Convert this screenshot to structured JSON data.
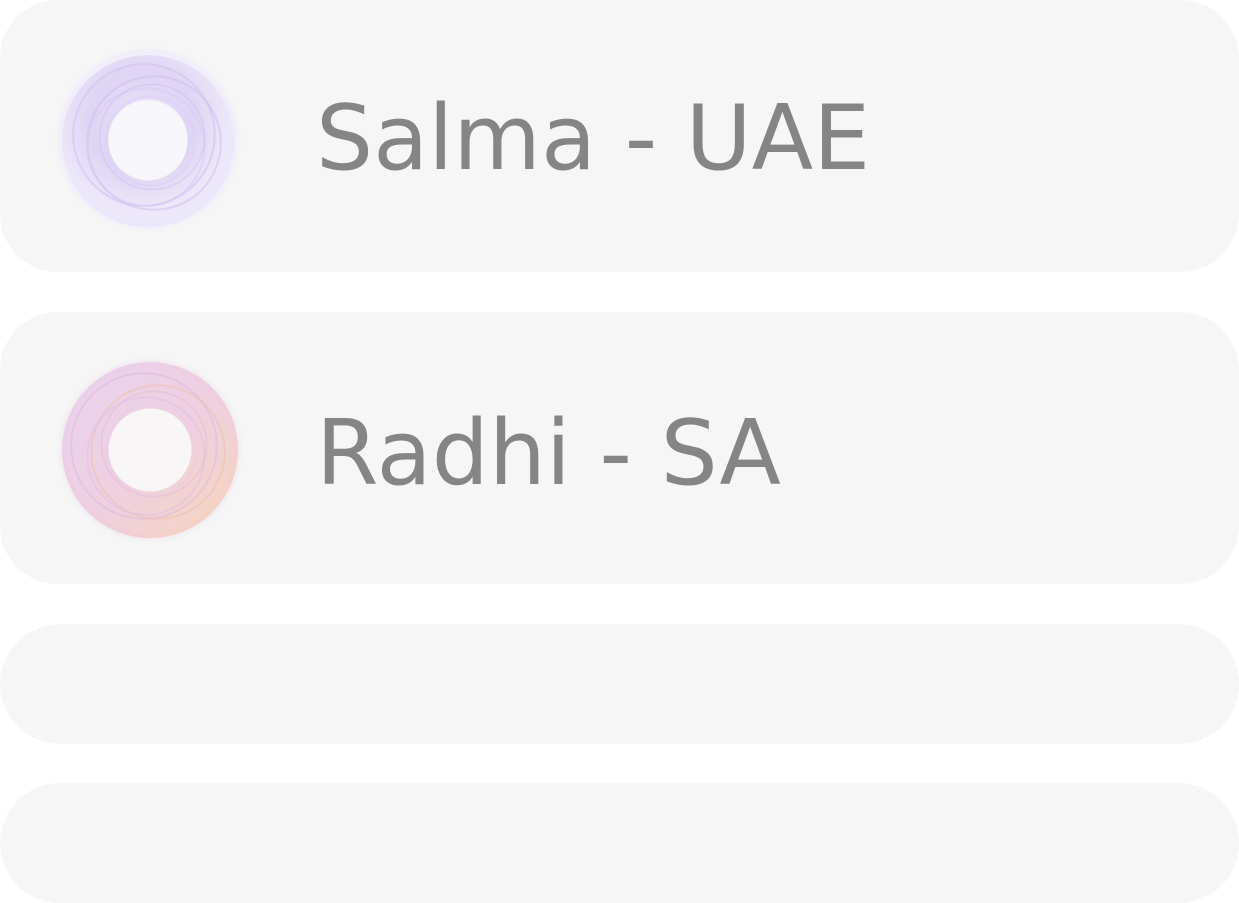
{
  "contacts": [
    {
      "name": "Salma - UAE",
      "avatar_icon": "gradient-ring-icon",
      "avatar_colors": [
        "#c9b6ee",
        "#dcd3f6",
        "#e6e0fa"
      ]
    },
    {
      "name": "Radhi - SA",
      "avatar_icon": "gradient-ring-icon",
      "avatar_colors": [
        "#e4bde6",
        "#f3c7b8",
        "#efcfe6"
      ]
    }
  ],
  "placeholders": 2,
  "colors": {
    "card_background": "#f6f6f6",
    "text": "#858585",
    "page_background": "#ffffff"
  }
}
